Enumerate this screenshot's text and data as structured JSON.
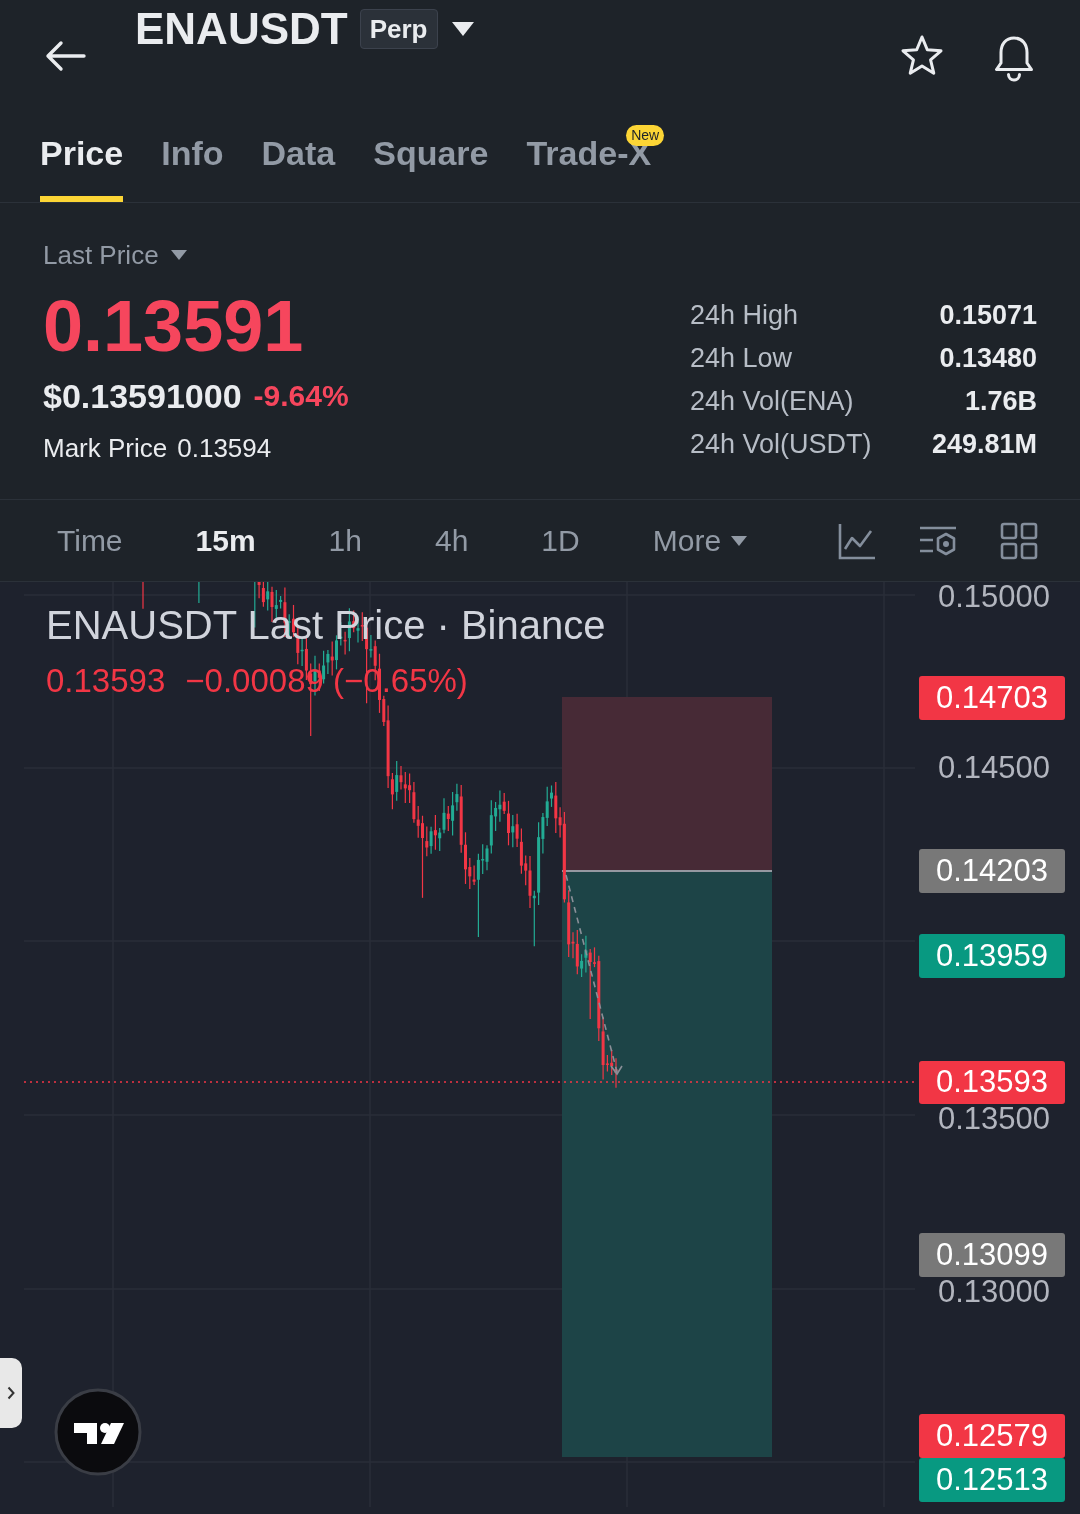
{
  "header": {
    "symbol": "ENAUSDT",
    "badge": "Perp"
  },
  "tabs": [
    {
      "label": "Price",
      "selected": true
    },
    {
      "label": "Info",
      "selected": false
    },
    {
      "label": "Data",
      "selected": false
    },
    {
      "label": "Square",
      "selected": false
    },
    {
      "label": "Trade-X",
      "selected": false,
      "badge": "New"
    }
  ],
  "price_panel": {
    "label": "Last Price",
    "last_price": "0.13591",
    "usd_price": "$0.13591000",
    "change": "-9.64%",
    "mark_label": "Mark Price",
    "mark_price": "0.13594"
  },
  "stats": [
    {
      "label": "24h High",
      "value": "0.15071"
    },
    {
      "label": "24h Low",
      "value": "0.13480"
    },
    {
      "label": "24h Vol(ENA)",
      "value": "1.76B"
    },
    {
      "label": "24h Vol(USDT)",
      "value": "249.81M"
    }
  ],
  "intervals": [
    {
      "label": "Time",
      "selected": false,
      "kind": "option"
    },
    {
      "label": "15m",
      "selected": true,
      "kind": "option"
    },
    {
      "label": "1h",
      "selected": false,
      "kind": "option"
    },
    {
      "label": "4h",
      "selected": false,
      "kind": "option"
    },
    {
      "label": "1D",
      "selected": false,
      "kind": "option"
    },
    {
      "label": "More",
      "selected": false,
      "kind": "menu"
    }
  ],
  "chart": {
    "title": "ENAUSDT Last Price · Binance",
    "last": "0.13593",
    "change": "−0.00089 (−0.65%)",
    "axis_labels": [
      "0.15000",
      "0.14500",
      "0.13500",
      "0.13000"
    ],
    "price_tags": [
      {
        "text": "0.14703",
        "color": "#f23645"
      },
      {
        "text": "0.14203",
        "color": "#787878"
      },
      {
        "text": "0.13959",
        "color": "#089981"
      },
      {
        "text": "0.13593",
        "color": "#f23645"
      },
      {
        "text": "0.13099",
        "color": "#787878"
      },
      {
        "text": "0.12579",
        "color": "#f23645"
      },
      {
        "text": "0.12513",
        "color": "#089981"
      }
    ]
  }
}
